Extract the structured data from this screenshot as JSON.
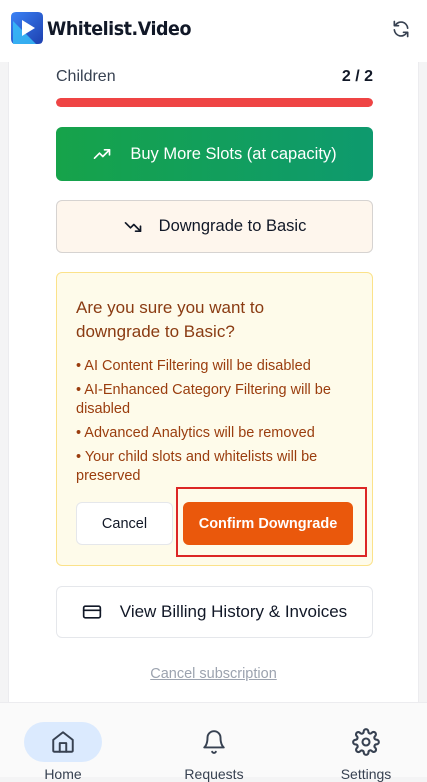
{
  "header": {
    "app_name": "Whitelist.Video"
  },
  "usage": {
    "children_label": "Children",
    "children_count": "2 / 2",
    "fill_fraction": 1.0
  },
  "actions": {
    "buy_more_label": "Buy More Slots (at capacity)",
    "downgrade_label": "Downgrade to Basic"
  },
  "confirm_dialog": {
    "title": "Are you sure you want to downgrade to Basic?",
    "bullets": [
      "• AI Content Filtering will be disabled",
      "• AI-Enhanced Category Filtering will be disabled",
      "• Advanced Analytics will be removed",
      "• Your child slots and whitelists will be preserved"
    ],
    "cancel_label": "Cancel",
    "confirm_label": "Confirm Downgrade"
  },
  "billing": {
    "label": "View Billing History & Invoices"
  },
  "cancel_subscription_label": "Cancel subscription",
  "bottom_nav": {
    "items": [
      {
        "label": "Home",
        "icon": "home-icon",
        "active": true
      },
      {
        "label": "Requests",
        "icon": "bell-icon",
        "active": false
      },
      {
        "label": "Settings",
        "icon": "gear-icon",
        "active": false
      }
    ]
  },
  "colors": {
    "danger": "#ef4444",
    "success_start": "#16a34a",
    "success_end": "#0e9a6e",
    "confirm_orange": "#ea580c",
    "nav_active_bg": "#dbeafe",
    "warning_text": "#9a3d0e"
  }
}
